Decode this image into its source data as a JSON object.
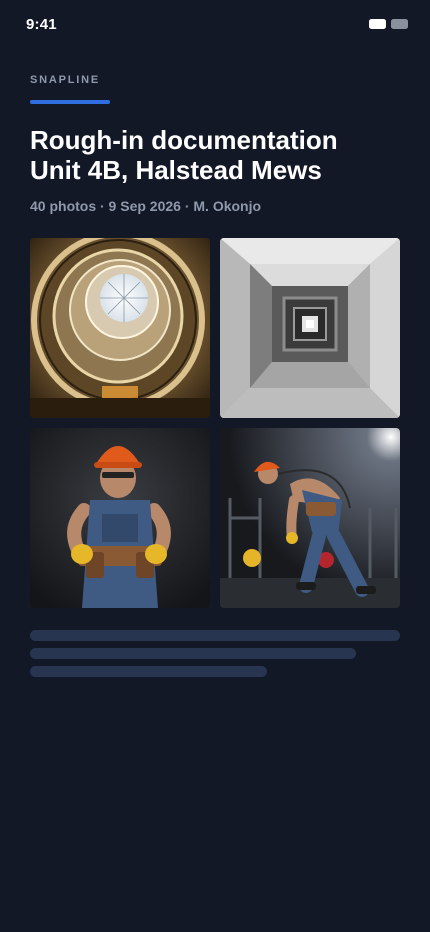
{
  "status_bar": {
    "time": "9:41",
    "icons": [
      "wifi-icon",
      "battery-icon"
    ]
  },
  "app": {
    "brand": "SNAPLINE",
    "accent_color": "#2f6ee0"
  },
  "album": {
    "title_line1": "Rough-in documentation",
    "title_line2": "Unit 4B, Halstead Mews",
    "meta": "40 photos · 9 Sep 2026 · M. Okonjo"
  },
  "photos": [
    {
      "subject": "spiral staircase skylight"
    },
    {
      "subject": "concrete corridor"
    },
    {
      "subject": "worker in hard hat with tool belt"
    },
    {
      "subject": "worker lifting in gym"
    }
  ],
  "loading_placeholder_lines": 3
}
